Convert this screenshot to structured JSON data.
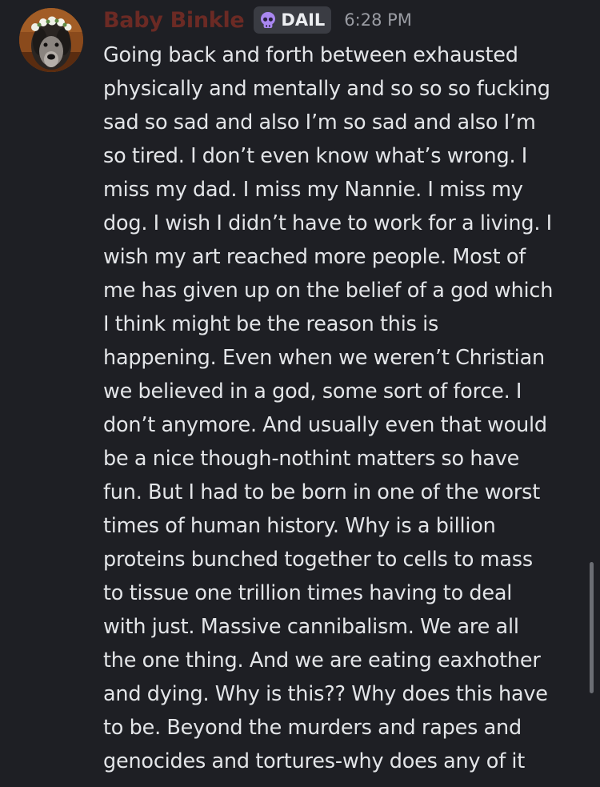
{
  "message": {
    "author": "Baby Binkle",
    "author_color": "#6b2a24",
    "tag": {
      "icon": "skull-icon",
      "label": "DAIL"
    },
    "timestamp": "6:28 PM",
    "avatar": "avatar-dog-flower-crown",
    "lines": [
      "Going back and forth between exhausted",
      "physically and mentally and so so so fucking",
      "sad so sad and also I’m so sad and also I’m",
      "so tired. I don’t even know what’s wrong. I",
      "miss my dad. I miss my Nannie. I miss my",
      "dog. I wish I didn’t have to work for a living. I",
      "wish my art reached more people. Most of",
      "me has given up on the belief of a god which",
      "I think might be the reason this is",
      "happening. Even when we weren’t Christian",
      "we believed in a god, some sort of force. I",
      "don’t anymore. And usually even that would",
      "be a nice though-nothint matters so have",
      "fun. But I had to be born in one of the worst",
      "times of human history. Why is a billion",
      "proteins bunched together to cells to mass",
      "to tissue one trillion times having to deal",
      "with just. Massive cannibalism. We are all",
      "the one thing. And we are eating eaxhother",
      "and dying. Why is this?? Why does this have",
      "to be. Beyond the murders and rapes and",
      "genocides and tortures-why does any of it"
    ]
  }
}
